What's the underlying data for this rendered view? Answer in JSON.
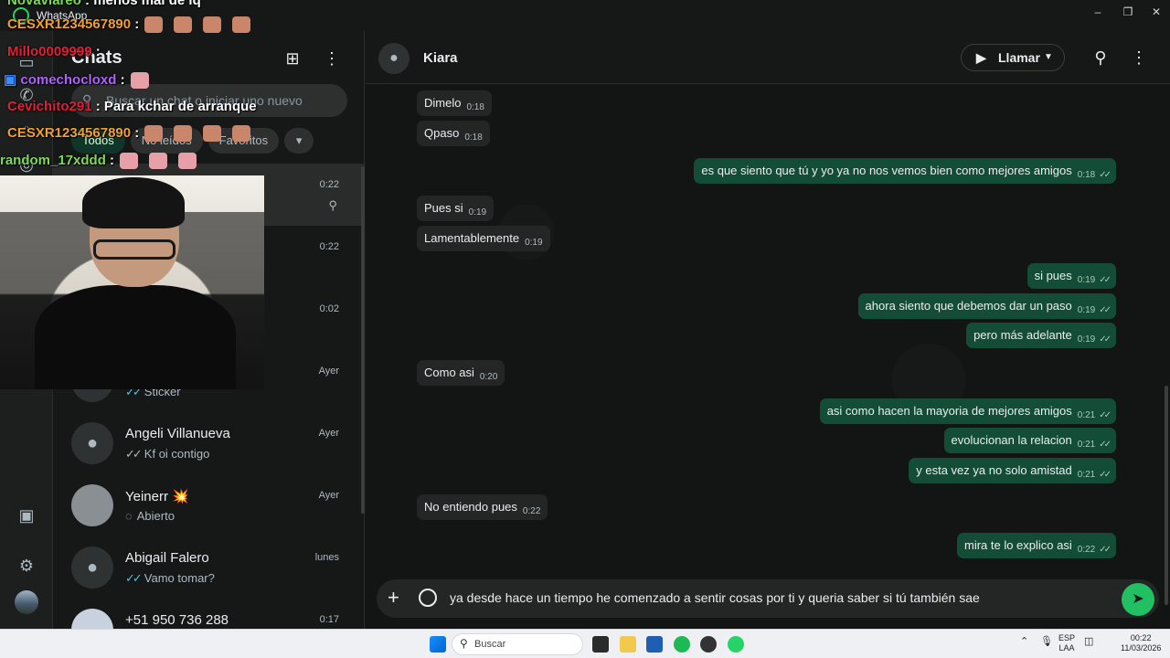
{
  "window": {
    "app_name": "WhatsApp",
    "minimize": "–",
    "maximize": "❐",
    "close": "✕"
  },
  "sidebar": {
    "header_title": "Chats"
  },
  "search": {
    "placeholder": "Buscar un chat o iniciar uno nuevo"
  },
  "filters": [
    "Todos",
    "No leídos",
    "Favoritos"
  ],
  "chats": [
    {
      "name": "",
      "preview": "",
      "time": "0:22",
      "pinned": true
    },
    {
      "name": "",
      "preview": "",
      "time": "0:22"
    },
    {
      "name": "",
      "preview": "",
      "time": "0:02"
    },
    {
      "name": "",
      "preview": "Sticker",
      "time": "Ayer"
    },
    {
      "name": "Angeli Villanueva",
      "preview": "Kf oi contigo",
      "time": "Ayer"
    },
    {
      "name": "Yeinerr 💥",
      "preview": "Abierto",
      "time": "Ayer"
    },
    {
      "name": "Abigail Falero",
      "preview": "Vamo tomar?",
      "time": "lunes"
    },
    {
      "name": "+51 950 736 288",
      "preview": "",
      "time": "0:17"
    }
  ],
  "conversation": {
    "contact_name": "Kiara",
    "call_label": "Llamar",
    "messages": [
      {
        "dir": "in",
        "text": "Dimelo",
        "time": "0:18"
      },
      {
        "dir": "in",
        "text": "Qpaso",
        "time": "0:18"
      },
      {
        "dir": "out",
        "text": "es que siento que tú y yo ya no nos vemos bien como mejores amigos",
        "time": "0:18"
      },
      {
        "dir": "in",
        "text": "Pues si",
        "time": "0:19"
      },
      {
        "dir": "in",
        "text": "Lamentablemente",
        "time": "0:19"
      },
      {
        "dir": "out",
        "text": "si pues",
        "time": "0:19"
      },
      {
        "dir": "out",
        "text": "ahora siento que debemos dar un paso",
        "time": "0:19"
      },
      {
        "dir": "out",
        "text": "pero más adelante",
        "time": "0:19"
      },
      {
        "dir": "in",
        "text": "Como asi",
        "time": "0:20"
      },
      {
        "dir": "out",
        "text": "asi como hacen la mayoria de mejores amigos",
        "time": "0:21"
      },
      {
        "dir": "out",
        "text": "evolucionan la relacion",
        "time": "0:21"
      },
      {
        "dir": "out",
        "text": "y esta vez ya no solo amistad",
        "time": "0:21"
      },
      {
        "dir": "in",
        "text": "No entiendo pues",
        "time": "0:22"
      },
      {
        "dir": "out",
        "text": "mira te lo explico asi",
        "time": "0:22"
      }
    ],
    "composer_text": "ya desde hace un tiempo he comenzado a sentir cosas por ti y queria saber si tú también sae"
  },
  "stream_chat": [
    {
      "user": "Novaviareo",
      "text": ": menos mal de iq",
      "color": "#7ed957"
    },
    {
      "user": "CESXR1234567890",
      "text": ":",
      "color": "#f0a030"
    },
    {
      "user": "Millo0009999",
      "text": ":",
      "color": "#e0203a"
    },
    {
      "user": "comechocloxd",
      "text": ":",
      "color": "#b060ff"
    },
    {
      "user": "Cevichito291",
      "text": ": Para kchar de arranque",
      "color": "#e0203a"
    },
    {
      "user": "CESXR1234567890",
      "text": ":",
      "color": "#f0a030"
    },
    {
      "user": "random_17xddd",
      "text": ":",
      "color": "#7ed957"
    }
  ],
  "taskbar": {
    "search_label": "Buscar",
    "lang": "ESP",
    "lang2": "LAA",
    "time": "00:22",
    "date": "11/03/2026"
  },
  "colors": {
    "accent": "#21c063",
    "outgoing_bubble": "#144d37",
    "incoming_bubble": "#242626",
    "read_tick": "#53bdeb"
  },
  "icons": [
    "new-chat-icon",
    "menu-icon",
    "search-icon",
    "video-icon",
    "pin-icon",
    "person-icon",
    "plus-icon",
    "emoji-icon",
    "send-icon",
    "settings-icon",
    "media-icon"
  ]
}
